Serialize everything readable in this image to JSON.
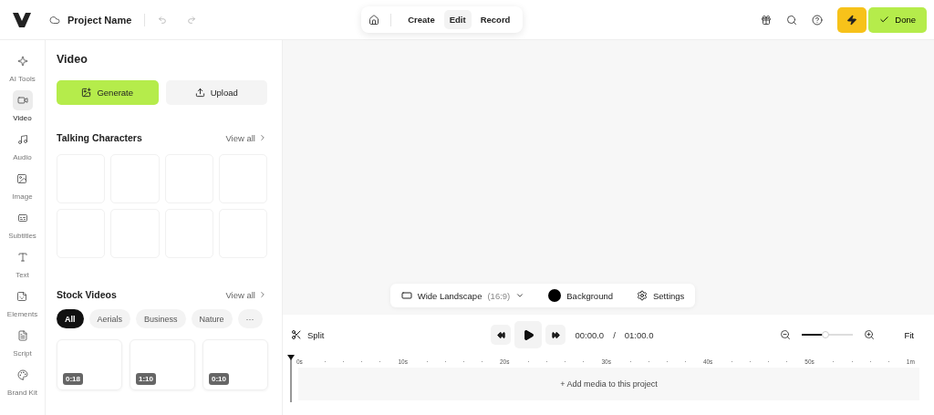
{
  "header": {
    "project_name": "Project Name",
    "modes": [
      {
        "label": "Create",
        "selected": false
      },
      {
        "label": "Edit",
        "selected": true
      },
      {
        "label": "Record",
        "selected": false
      }
    ],
    "done_label": "Done"
  },
  "rail": [
    {
      "label": "AI Tools",
      "selected": false
    },
    {
      "label": "Video",
      "selected": true
    },
    {
      "label": "Audio",
      "selected": false
    },
    {
      "label": "Image",
      "selected": false
    },
    {
      "label": "Subtitles",
      "selected": false
    },
    {
      "label": "Text",
      "selected": false
    },
    {
      "label": "Elements",
      "selected": false
    },
    {
      "label": "Script",
      "selected": false
    },
    {
      "label": "Brand Kit",
      "selected": false
    }
  ],
  "panel": {
    "title": "Video",
    "generate_label": "Generate",
    "upload_label": "Upload",
    "talking": {
      "title": "Talking Characters",
      "view_all": "View all"
    },
    "stock": {
      "title": "Stock Videos",
      "view_all": "View all",
      "chips": [
        {
          "label": "All",
          "selected": true
        },
        {
          "label": "Aerials",
          "selected": false
        },
        {
          "label": "Business",
          "selected": false
        },
        {
          "label": "Nature",
          "selected": false
        }
      ],
      "more": "···",
      "videos": [
        {
          "duration": "0:18"
        },
        {
          "duration": "1:10"
        },
        {
          "duration": "0:10"
        }
      ]
    }
  },
  "stage_bar": {
    "format": "Wide Landscape",
    "ratio": "(16:9)",
    "background_label": "Background",
    "settings_label": "Settings"
  },
  "timeline": {
    "split_label": "Split",
    "current_time": "00:00.0",
    "separator": "/",
    "total_time": "01:00.0",
    "zoom": {
      "level": 0.45
    },
    "fit_label": "Fit",
    "ticks": [
      "0s",
      "10s",
      "20s",
      "30s",
      "40s",
      "50s",
      "1m"
    ],
    "add_media": "Add media to this project",
    "add_icon": "+"
  }
}
